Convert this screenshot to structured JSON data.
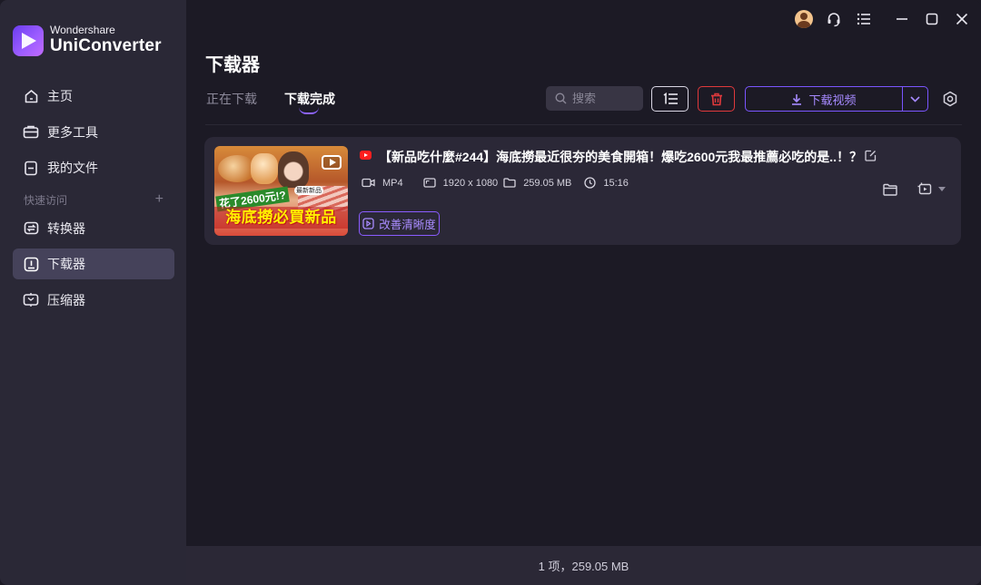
{
  "app": {
    "brand": "Wondershare",
    "name": "UniConverter",
    "accent": "#7a55ff"
  },
  "sidebar": {
    "items_top": [
      {
        "label": "主页",
        "icon": "home-icon"
      },
      {
        "label": "更多工具",
        "icon": "toolbox-icon"
      },
      {
        "label": "我的文件",
        "icon": "file-icon"
      }
    ],
    "quick_access_label": "快速访问",
    "quick_add": "+",
    "items_quick": [
      {
        "label": "转换器",
        "icon": "converter-icon"
      },
      {
        "label": "下载器",
        "icon": "downloader-icon",
        "active": true
      },
      {
        "label": "压缩器",
        "icon": "compressor-icon"
      }
    ]
  },
  "page": {
    "title": "下载器",
    "tabs": [
      {
        "label": "正在下载",
        "active": false
      },
      {
        "label": "下载完成",
        "active": true
      }
    ],
    "search_placeholder": "搜索",
    "download_button": "下载视频"
  },
  "downloads": [
    {
      "source": "youtube-icon",
      "title": "【新品吃什麼#244】海底撈最近很夯的美食開箱！爆吃2600元我最推薦必吃的是..！？",
      "format": "MP4",
      "resolution": "1920 x 1080",
      "size": "259.05 MB",
      "duration": "15:16",
      "enhance_label": "改善清晰度",
      "thumb_caption_small": "花了2600元!?",
      "thumb_caption_big": "海底撈必買新品",
      "thumb_badge": "最新新品"
    }
  ],
  "footer": {
    "summary": "1 项，259.05 MB"
  }
}
